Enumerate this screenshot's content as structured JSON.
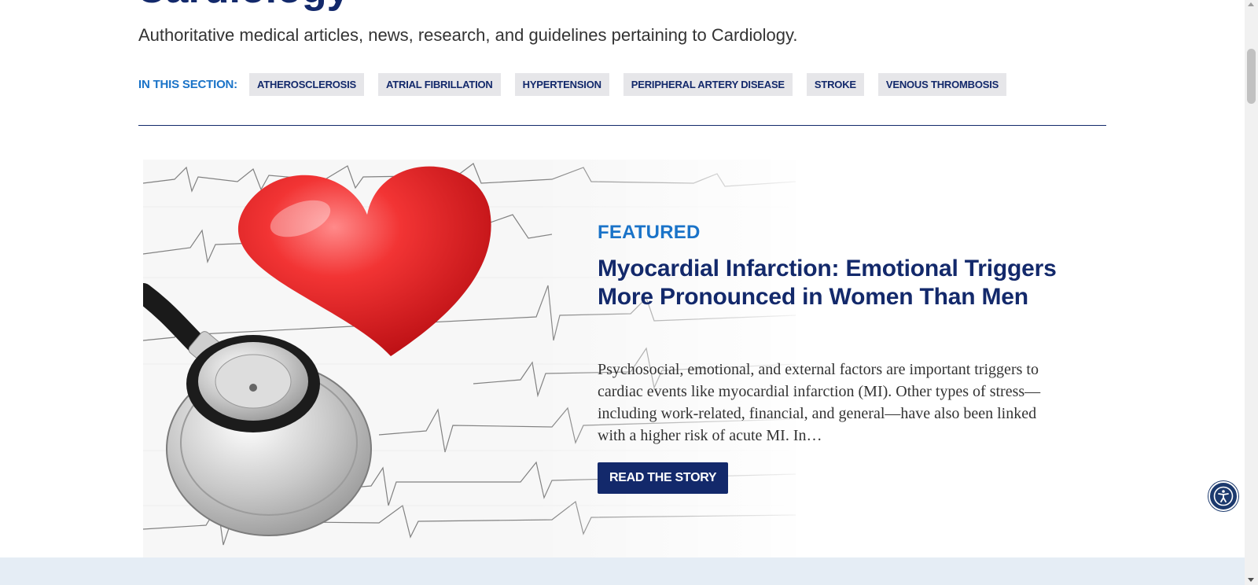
{
  "header": {
    "title": "Cardiology",
    "subtitle": "Authoritative medical articles, news, research, and guidelines pertaining to Cardiology."
  },
  "section_nav": {
    "label": "IN THIS SECTION:",
    "tags": [
      "ATHEROSCLEROSIS",
      "ATRIAL FIBRILLATION",
      "HYPERTENSION",
      "PERIPHERAL ARTERY DISEASE",
      "STROKE",
      "VENOUS THROMBOSIS"
    ]
  },
  "featured": {
    "label": "FEATURED",
    "title": "Myocardial Infarction: Emotional Triggers More Pronounced in Women Than Men",
    "excerpt": "Psychosocial, emotional, and external factors are important triggers to cardiac events like myocardial infarction (MI). Other types of stress—including work-related, financial, and general—have also been linked with a higher risk of acute MI. In…",
    "button_label": "READ THE STORY",
    "image_icon": "heart-stethoscope-ecg-image"
  },
  "accessibility": {
    "icon": "accessibility-icon"
  },
  "colors": {
    "navy": "#13296b",
    "accent_blue": "#1a73c8",
    "tag_bg": "#e6e6e9",
    "footer_band": "#e5edf5"
  }
}
